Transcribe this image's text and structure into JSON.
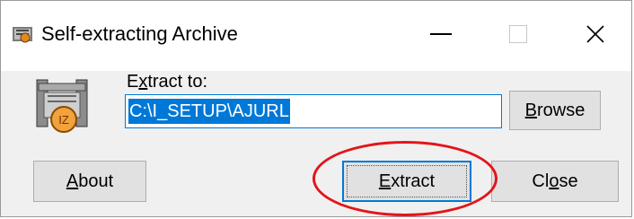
{
  "window": {
    "title": "Self-extracting Archive",
    "icon": "winzip-archive-icon"
  },
  "controls": {
    "minimize": "minimize-icon",
    "maximize": "maximize-icon",
    "close": "close-icon"
  },
  "form": {
    "extract_label_prefix": "E",
    "extract_label_underlined": "x",
    "extract_label_rest": "tract to:",
    "path_value": "C:\\I_SETUP\\AJURL"
  },
  "buttons": {
    "browse_u": "B",
    "browse_rest": "rowse",
    "about_u": "A",
    "about_rest": "bout",
    "extract_u": "E",
    "extract_rest": "xtract",
    "close_pre": "Cl",
    "close_u": "o",
    "close_rest": "se"
  },
  "annotation": {
    "highlight_color": "#e4141b"
  }
}
